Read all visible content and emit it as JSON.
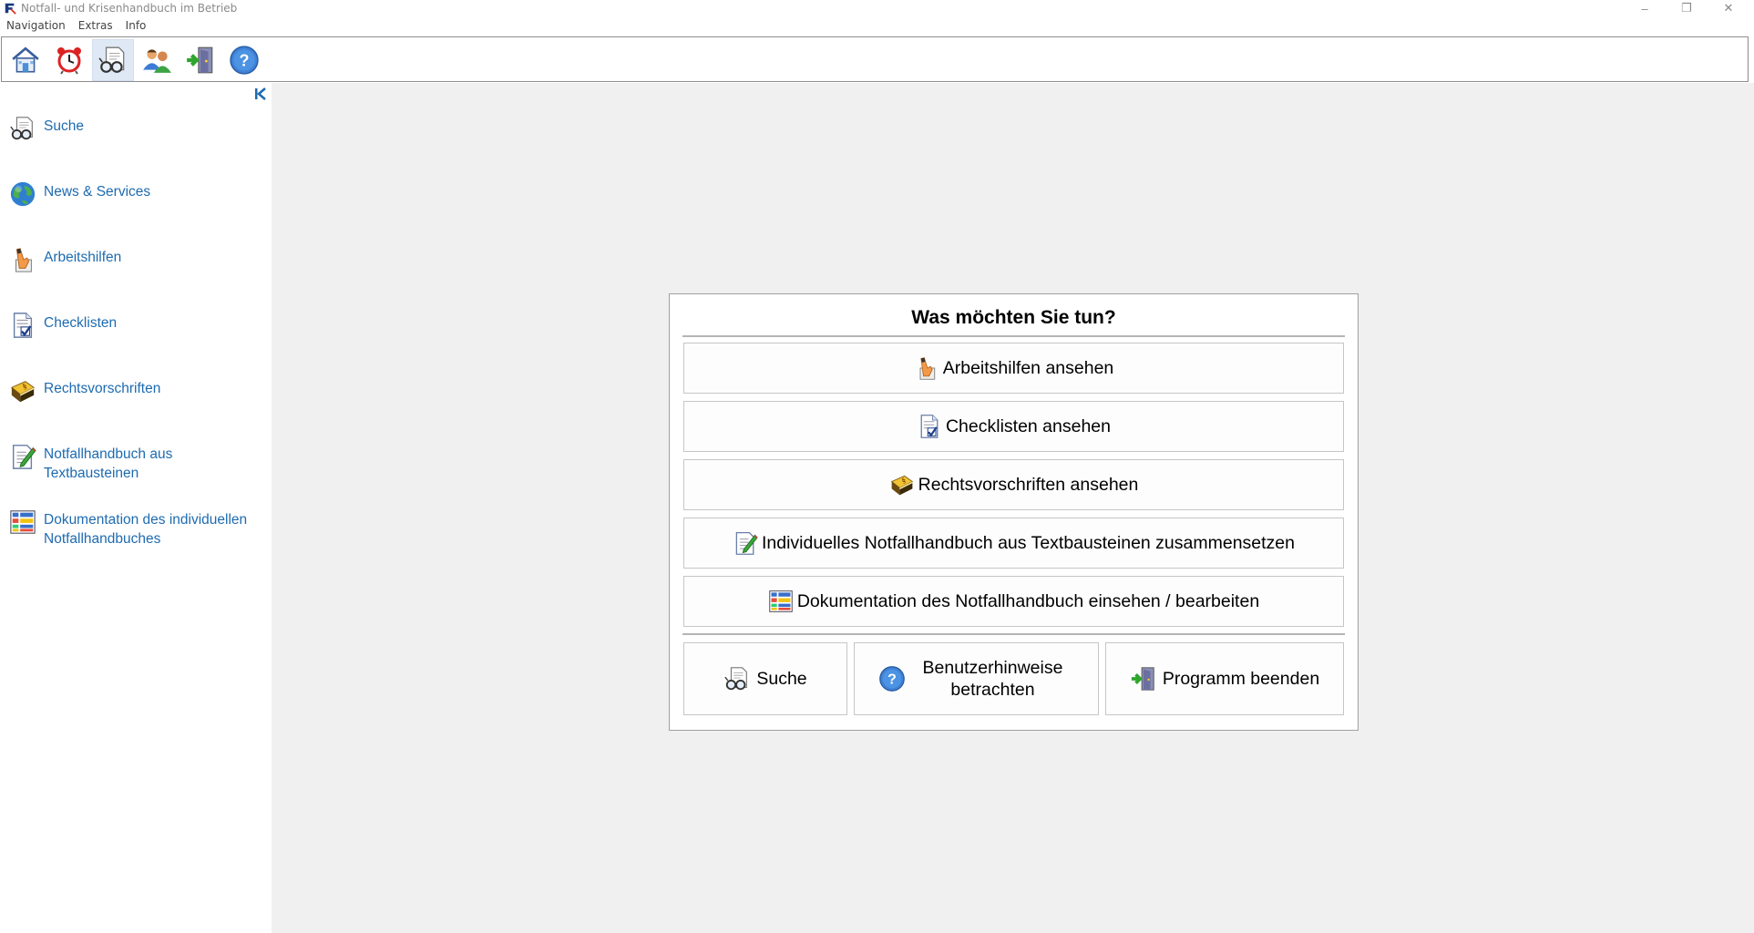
{
  "window": {
    "title": "Notfall- und Krisenhandbuch im Betrieb",
    "controls": {
      "minimize": "–",
      "maximize": "❐",
      "close": "✕"
    }
  },
  "menu": [
    "Navigation",
    "Extras",
    "Info"
  ],
  "toolbar": {
    "buttons": [
      {
        "name": "home-icon"
      },
      {
        "name": "alarm-clock-icon"
      },
      {
        "name": "search-glasses-icon",
        "active": true
      },
      {
        "name": "users-icon"
      },
      {
        "name": "exit-door-icon"
      },
      {
        "name": "help-icon"
      }
    ]
  },
  "sidebar": {
    "items": [
      {
        "label": "Suche",
        "icon": "search-glasses-icon"
      },
      {
        "label": "News & Services",
        "icon": "globe-icon"
      },
      {
        "label": "Arbeitshilfen",
        "icon": "hand-icon"
      },
      {
        "label": "Checklisten",
        "icon": "checklist-icon"
      },
      {
        "label": "Rechtsvorschriften",
        "icon": "law-book-icon"
      },
      {
        "label": "Notfallhandbuch aus Textbausteinen",
        "icon": "edit-document-icon"
      },
      {
        "label": "Dokumentation des individuellen Notfallhandbuches",
        "icon": "documentation-grid-icon"
      }
    ]
  },
  "panel": {
    "title": "Was möchten Sie tun?",
    "buttons": [
      {
        "label": "Arbeitshilfen ansehen",
        "icon": "hand-icon"
      },
      {
        "label": "Checklisten ansehen",
        "icon": "checklist-icon"
      },
      {
        "label": "Rechtsvorschriften ansehen",
        "icon": "law-book-icon"
      },
      {
        "label": "Individuelles Notfallhandbuch aus Textbausteinen zusammensetzen",
        "icon": "edit-document-icon"
      },
      {
        "label": "Dokumentation des Notfallhandbuch einsehen / bearbeiten",
        "icon": "documentation-grid-icon"
      }
    ],
    "bottom_buttons": [
      {
        "label": "Suche",
        "icon": "search-glasses-icon"
      },
      {
        "label": "Benutzerhinweise betrachten",
        "icon": "help-icon"
      },
      {
        "label": "Programm beenden",
        "icon": "exit-door-icon"
      }
    ]
  },
  "colors": {
    "link": "#1e6bb0",
    "main_bg": "#f0f0f0",
    "active_tool": "#dfe9f5"
  }
}
